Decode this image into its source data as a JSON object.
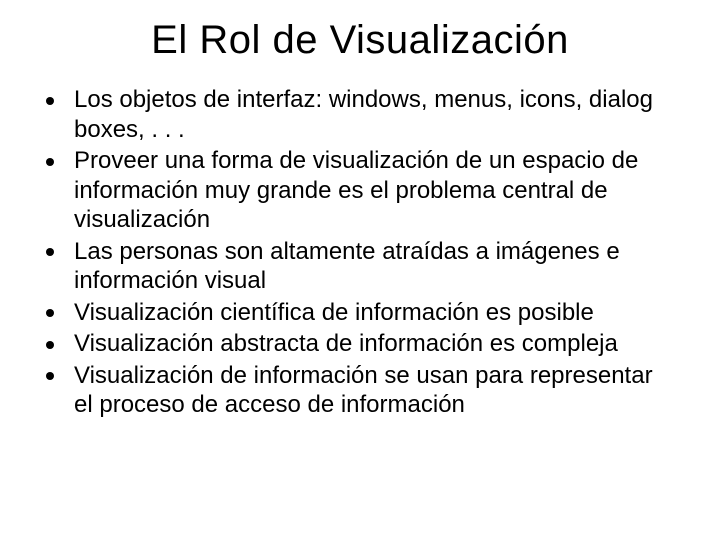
{
  "title": "El Rol de Visualización",
  "bullets": [
    "Los objetos de interfaz: windows, menus, icons, dialog boxes, . . .",
    "Proveer una forma de visualización de un espacio de información muy grande es el problema central de visualización",
    "Las personas son altamente atraídas a imágenes e información visual",
    "Visualización científica de información es posible",
    "Visualización abstracta de información es compleja",
    "Visualización de información se usan para representar el proceso de acceso de información"
  ]
}
